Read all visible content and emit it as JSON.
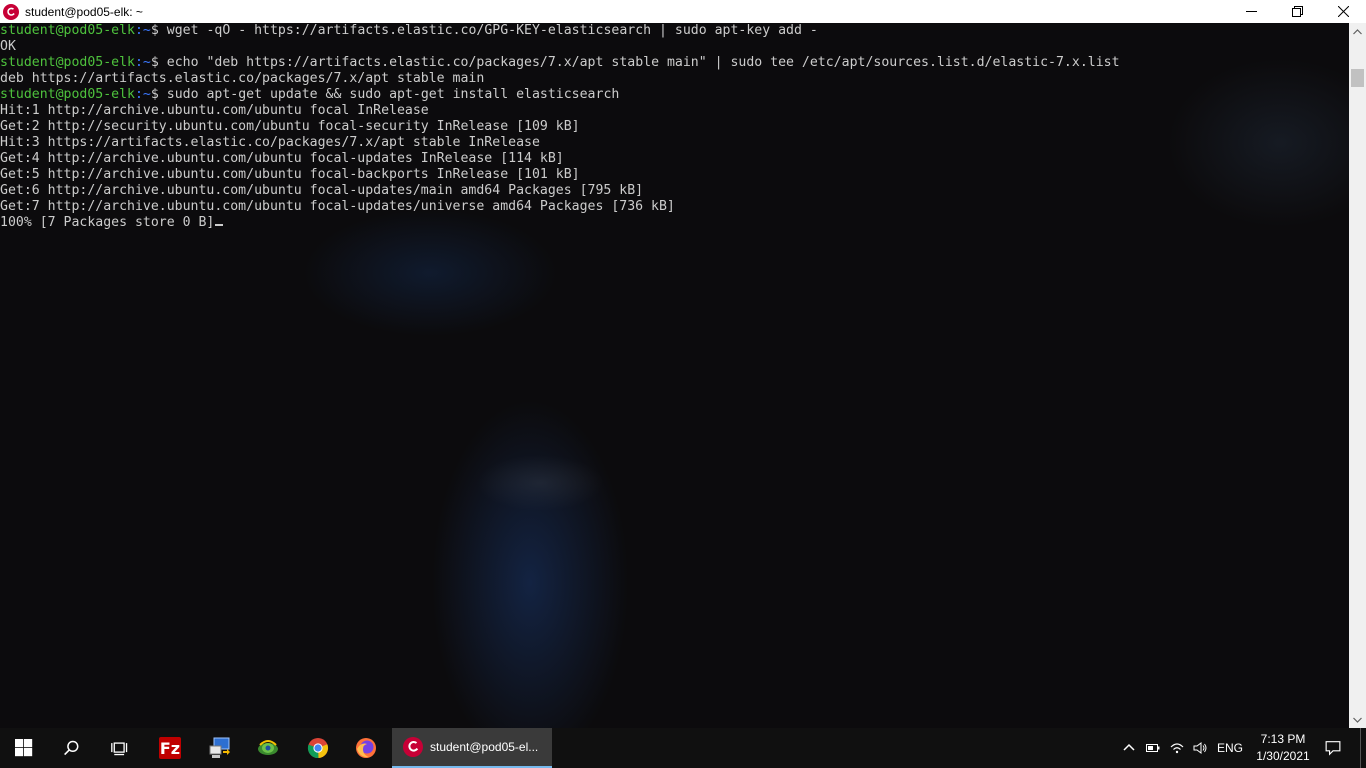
{
  "window": {
    "title": "student@pod05-elk: ~"
  },
  "terminal": {
    "lines": [
      {
        "type": "prompt",
        "user": "student@pod05-elk",
        "path": ":~",
        "sigil": "$ ",
        "command": "wget -qO - https://artifacts.elastic.co/GPG-KEY-elasticsearch | sudo apt-key add -"
      },
      {
        "type": "output",
        "text": "OK"
      },
      {
        "type": "prompt",
        "user": "student@pod05-elk",
        "path": ":~",
        "sigil": "$ ",
        "command": "echo \"deb https://artifacts.elastic.co/packages/7.x/apt stable main\" | sudo tee /etc/apt/sources.list.d/elastic-7.x.list"
      },
      {
        "type": "output",
        "text": "deb https://artifacts.elastic.co/packages/7.x/apt stable main"
      },
      {
        "type": "prompt",
        "user": "student@pod05-elk",
        "path": ":~",
        "sigil": "$ ",
        "command": "sudo apt-get update && sudo apt-get install elasticsearch"
      },
      {
        "type": "output",
        "text": "Hit:1 http://archive.ubuntu.com/ubuntu focal InRelease"
      },
      {
        "type": "output",
        "text": "Get:2 http://security.ubuntu.com/ubuntu focal-security InRelease [109 kB]"
      },
      {
        "type": "output",
        "text": "Hit:3 https://artifacts.elastic.co/packages/7.x/apt stable InRelease"
      },
      {
        "type": "output",
        "text": "Get:4 http://archive.ubuntu.com/ubuntu focal-updates InRelease [114 kB]"
      },
      {
        "type": "output",
        "text": "Get:5 http://archive.ubuntu.com/ubuntu focal-backports InRelease [101 kB]"
      },
      {
        "type": "output",
        "text": "Get:6 http://archive.ubuntu.com/ubuntu focal-updates/main amd64 Packages [795 kB]"
      },
      {
        "type": "output",
        "text": "Get:7 http://archive.ubuntu.com/ubuntu focal-updates/universe amd64 Packages [736 kB]"
      },
      {
        "type": "output",
        "text": "100% [7 Packages store 0 B]",
        "cursor": true
      }
    ],
    "colors": {
      "foreground": "#cccccc",
      "prompt_user": "#4ec23d",
      "prompt_path": "#3b78ff"
    }
  },
  "taskbar": {
    "apps": [
      {
        "name": "start-button",
        "icon": "windows-logo-icon"
      },
      {
        "name": "search-button",
        "icon": "search-icon"
      },
      {
        "name": "task-view-button",
        "icon": "task-view-icon"
      },
      {
        "name": "filezilla-app",
        "icon": "filezilla-icon"
      },
      {
        "name": "remote-desktop-app",
        "icon": "remote-desktop-icon"
      },
      {
        "name": "network-app",
        "icon": "globe-network-icon"
      },
      {
        "name": "chrome-app",
        "icon": "chrome-icon"
      },
      {
        "name": "firefox-app",
        "icon": "firefox-icon"
      }
    ],
    "active_app_label": "student@pod05-el...",
    "language": "ENG",
    "clock": {
      "time": "7:13 PM",
      "date": "1/30/2021"
    }
  }
}
